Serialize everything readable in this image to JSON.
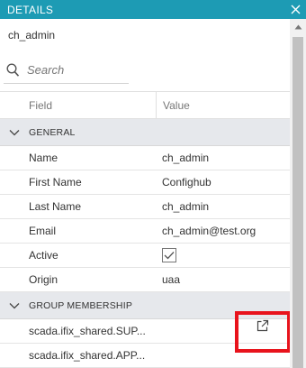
{
  "panel": {
    "title": "DETAILS",
    "close_icon": "close-icon"
  },
  "user": {
    "name": "ch_admin"
  },
  "search": {
    "placeholder": "Search",
    "value": ""
  },
  "table": {
    "headers": {
      "field": "Field",
      "value": "Value"
    },
    "general": {
      "title": "GENERAL",
      "rows": [
        {
          "field": "Name",
          "value": "ch_admin"
        },
        {
          "field": "First Name",
          "value": "Confighub"
        },
        {
          "field": "Last Name",
          "value": "ch_admin"
        },
        {
          "field": "Email",
          "value": "ch_admin@test.org"
        },
        {
          "field": "Active",
          "value": ""
        },
        {
          "field": "Origin",
          "value": "uaa"
        }
      ]
    },
    "group_membership": {
      "title": "GROUP MEMBERSHIP",
      "rows": [
        {
          "name": "scada.ifix_shared.SUP..."
        },
        {
          "name": "scada.ifix_shared.APP..."
        }
      ]
    }
  },
  "colors": {
    "titlebar": "#1d9bb4",
    "highlight": "#e8131c",
    "group_bg": "#e6e8ec"
  }
}
